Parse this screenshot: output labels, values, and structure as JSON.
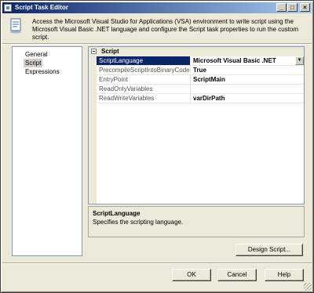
{
  "window": {
    "title": "Script Task Editor",
    "controls": {
      "minimize": "_",
      "maximize": "□",
      "close": "×"
    }
  },
  "header": {
    "description": "Access the Microsoft Visual Studio for Applications (VSA) environment to write script using the Microsoft Visual Basic .NET language and configure the Script task properties to run the custom script."
  },
  "nav": {
    "items": [
      {
        "label": "General"
      },
      {
        "label": "Script"
      },
      {
        "label": "Expressions"
      }
    ],
    "selected": "Script"
  },
  "grid": {
    "category": "Script",
    "properties": [
      {
        "name": "ScriptLanguage",
        "value": "Microsoft Visual Basic .NET"
      },
      {
        "name": "PrecompileScriptIntoBinaryCode",
        "value": "True"
      },
      {
        "name": "EntryPoint",
        "value": "ScriptMain"
      },
      {
        "name": "ReadOnlyVariables",
        "value": ""
      },
      {
        "name": "ReadWriteVariables",
        "value": "varDirPath"
      }
    ],
    "dropdown_glyph": "▼"
  },
  "description_panel": {
    "title": "ScriptLanguage",
    "text": "Specifies the scripting language."
  },
  "buttons": {
    "design_script": "Design Script...",
    "ok": "OK",
    "cancel": "Cancel",
    "help": "Help"
  },
  "colors": {
    "title_gradient_start": "#0a246a",
    "title_gradient_end": "#a6caf0",
    "selection": "#0a246a",
    "dialog_bg": "#ece9d8"
  }
}
